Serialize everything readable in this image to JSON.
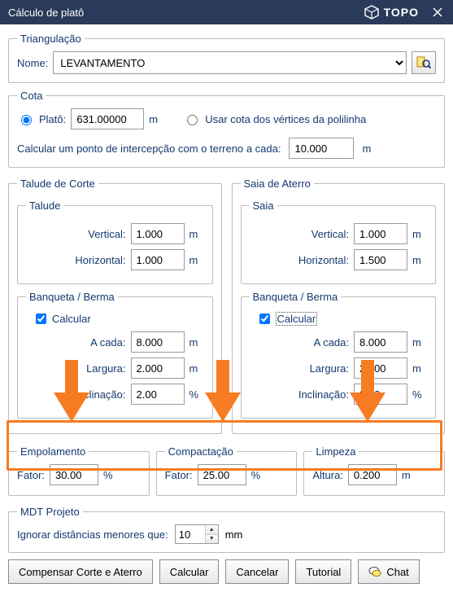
{
  "titlebar": {
    "title": "Cálculo de platô",
    "brand": "TOPO"
  },
  "triangulacao": {
    "legend": "Triangulação",
    "nome_label": "Nome:",
    "nome_value": "LEVANTAMENTO"
  },
  "cota": {
    "legend": "Cota",
    "platô_label": "Platô:",
    "platô_value": "631.00000",
    "platô_unit": "m",
    "usar_vertices_label": "Usar cota dos vértices da polilinha",
    "calc_inter_label": "Calcular um ponto de intercepção com o terreno a cada:",
    "calc_inter_value": "10.000",
    "calc_inter_unit": "m"
  },
  "corte": {
    "legend": "Talude de Corte",
    "talude_legend": "Talude",
    "vertical_label": "Vertical:",
    "vertical_value": "1.000",
    "horizontal_label": "Horizontal:",
    "horizontal_value": "1.000",
    "unit": "m",
    "banqueta_legend": "Banqueta / Berma",
    "calcular_label": "Calcular",
    "a_cada_label": "A cada:",
    "a_cada_value": "8.000",
    "largura_label": "Largura:",
    "largura_value": "2.000",
    "inclinacao_label": "Inclinação:",
    "inclinacao_value": "2.00",
    "pct": "%"
  },
  "aterro": {
    "legend": "Saia de Aterro",
    "saia_legend": "Saia",
    "vertical_label": "Vertical:",
    "vertical_value": "1.000",
    "horizontal_label": "Horizontal:",
    "horizontal_value": "1.500",
    "unit": "m",
    "banqueta_legend": "Banqueta / Berma",
    "calcular_label": "Calcular",
    "a_cada_label": "A cada:",
    "a_cada_value": "8.000",
    "largura_label": "Largura:",
    "largura_value": "2.000",
    "inclinacao_label": "Inclinação:",
    "inclinacao_value": "2.00",
    "pct": "%"
  },
  "empolamento": {
    "legend": "Empolamento",
    "fator_label": "Fator:",
    "fator_value": "30.00",
    "unit": "%"
  },
  "compactacao": {
    "legend": "Compactação",
    "fator_label": "Fator:",
    "fator_value": "25.00",
    "unit": "%"
  },
  "limpeza": {
    "legend": "Limpeza",
    "altura_label": "Altura:",
    "altura_value": "0.200",
    "unit": "m"
  },
  "mdt": {
    "legend": "MDT Projeto",
    "ignore_label": "Ignorar distâncias menores que:",
    "ignore_value": "10",
    "unit": "mm"
  },
  "buttons": {
    "compensar": "Compensar Corte e Aterro",
    "calcular": "Calcular",
    "cancelar": "Cancelar",
    "tutorial": "Tutorial",
    "chat": "Chat"
  },
  "highlight_color": "#f77b23"
}
